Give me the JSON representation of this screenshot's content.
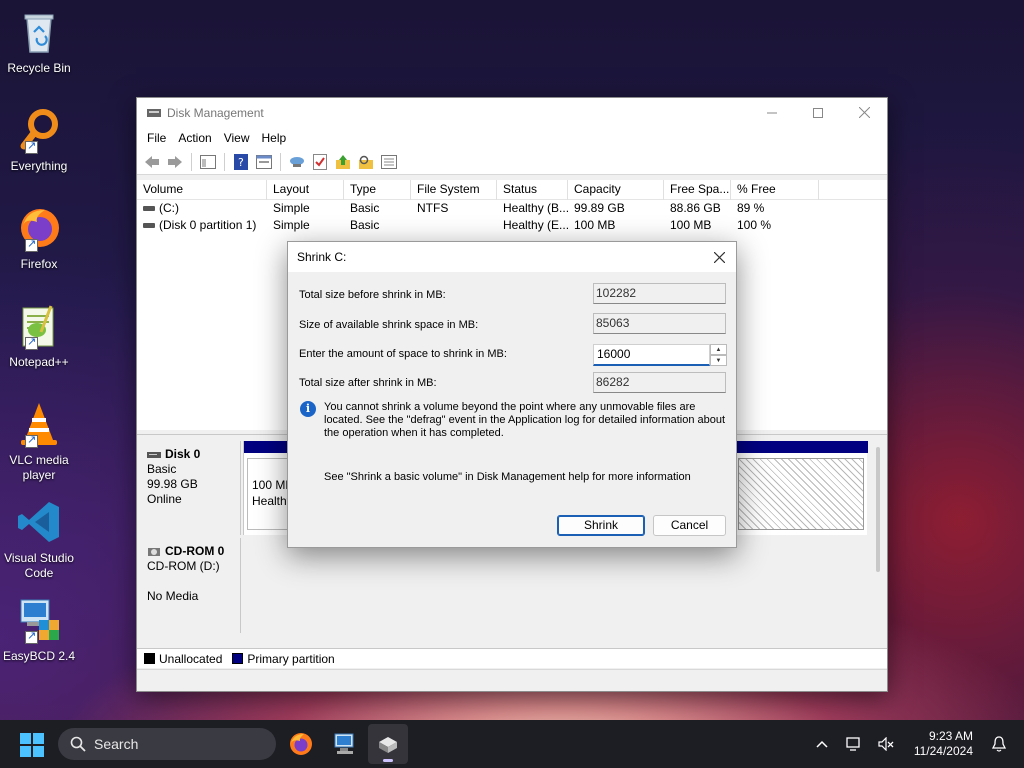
{
  "desktop": {
    "icons": [
      {
        "label": "Recycle Bin"
      },
      {
        "label": "Everything"
      },
      {
        "label": "Firefox"
      },
      {
        "label": "Notepad++"
      },
      {
        "label": "VLC media player"
      },
      {
        "label": "Visual Studio Code"
      },
      {
        "label": "EasyBCD 2.4"
      }
    ]
  },
  "window": {
    "title": "Disk Management",
    "menu": [
      "File",
      "Action",
      "View",
      "Help"
    ],
    "list": {
      "columns": [
        "Volume",
        "Layout",
        "Type",
        "File System",
        "Status",
        "Capacity",
        "Free Spa...",
        "% Free"
      ],
      "rows": [
        [
          "(C:)",
          "Simple",
          "Basic",
          "NTFS",
          "Healthy (B...",
          "99.89 GB",
          "88.86 GB",
          "89 %"
        ],
        [
          "(Disk 0 partition 1)",
          "Simple",
          "Basic",
          "",
          "Healthy (E...",
          "100 MB",
          "100 MB",
          "100 %"
        ]
      ]
    },
    "disks": [
      {
        "name": "Disk 0",
        "type": "Basic",
        "size": "99.98 GB",
        "status": "Online",
        "partition_size": "100 MB",
        "partition_status": "Healthy"
      },
      {
        "name": "CD-ROM 0",
        "type": "CD-ROM (D:)",
        "status": "No Media"
      }
    ],
    "legend": [
      {
        "label": "Unallocated",
        "color": "#000000"
      },
      {
        "label": "Primary partition",
        "color": "#000080"
      }
    ]
  },
  "dialog": {
    "title": "Shrink C:",
    "fields": [
      {
        "label": "Total size before shrink in MB:",
        "value": "102282"
      },
      {
        "label": "Size of available shrink space in MB:",
        "value": "85063"
      },
      {
        "label": "Enter the amount of space to shrink in MB:",
        "value": "16000"
      },
      {
        "label": "Total size after shrink in MB:",
        "value": "86282"
      }
    ],
    "info_text": "You cannot shrink a volume beyond the point where any unmovable files are located. See the \"defrag\" event in the Application log for detailed information about the operation when it has completed.",
    "help_text": "See \"Shrink a basic volume\" in Disk Management help for more information",
    "buttons": {
      "shrink": "Shrink",
      "cancel": "Cancel"
    }
  },
  "taskbar": {
    "search_placeholder": "Search",
    "time": "9:23 AM",
    "date": "11/24/2024"
  },
  "colors": {
    "accent": "#1a5fb4",
    "primary_partition": "#000080"
  }
}
